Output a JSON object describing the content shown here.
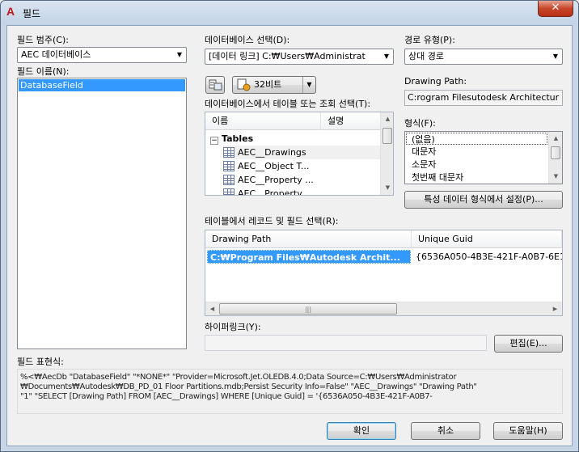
{
  "window": {
    "title": "필드",
    "close": "✕"
  },
  "field_category": {
    "label": "필드 범주(C):",
    "value": "AEC 데이터베이스"
  },
  "field_names": {
    "label": "필드 이름(N):",
    "items": [
      "DatabaseField"
    ]
  },
  "database_select": {
    "label": "데이터베이스 선택(D):",
    "value": "[데이터 링크] C:₩Users₩Administrat"
  },
  "path_type": {
    "label": "경로 유형(P):",
    "value": "상대 경로"
  },
  "drawing_path": {
    "label": "Drawing Path:",
    "value": "C:rogram Filesutodesk Architectur"
  },
  "toolbar": {
    "bitness_label": "32비트",
    "dropdown_arrow": "▼"
  },
  "table_select": {
    "label": "데이터베이스에서 테이블 또는 조회 선택(T):",
    "col_name": "이름",
    "col_desc": "설명",
    "root": "Tables",
    "root_toggle": "⊟",
    "items": [
      "AEC__Drawings",
      "AEC__Object T...",
      "AEC__Property ...",
      "AEC__Property..."
    ]
  },
  "format": {
    "label": "형식(F):",
    "items": [
      "(없음)",
      "대문자",
      "소문자",
      "첫번째 대문자"
    ],
    "set_button": "특성 데이터 형식에서 설정(P)..."
  },
  "records": {
    "label": "테이블에서 레코드 및 필드 선택(R):",
    "columns": [
      "Drawing Path",
      "Unique Guid"
    ],
    "rows": [
      [
        "C:₩Program Files₩Autodesk Archit...",
        "{6536A050-4B3E-421F-A0B7-6E1"
      ]
    ]
  },
  "hyperlink": {
    "label": "하이퍼링크(Y):",
    "value": "",
    "edit_button": "편집(E)..."
  },
  "expression": {
    "label": "필드 표현식:",
    "lines": [
      "%<₩AecDb \"DatabaseField\" \"*NONE*\" \"Provider=Microsoft.Jet.OLEDB.4.0;Data Source=C:₩Users₩Administrator",
      "₩Documents₩Autodesk₩DB_PD_01 Floor Partitions.mdb;Persist Security Info=False\" \"AEC__Drawings\" \"Drawing Path\"",
      "\"1\" \"SELECT [Drawing Path] FROM [AEC__Drawings] WHERE [Unique Guid] = '{6536A050-4B3E-421F-A0B7-"
    ]
  },
  "buttons": {
    "ok": "확인",
    "cancel": "취소",
    "help": "도움말(H)"
  },
  "icons": {
    "app": "autocad-app-icon",
    "db_connect": "database-connection-icon",
    "table": "table-icon",
    "tree_toggle": "collapse-icon"
  }
}
